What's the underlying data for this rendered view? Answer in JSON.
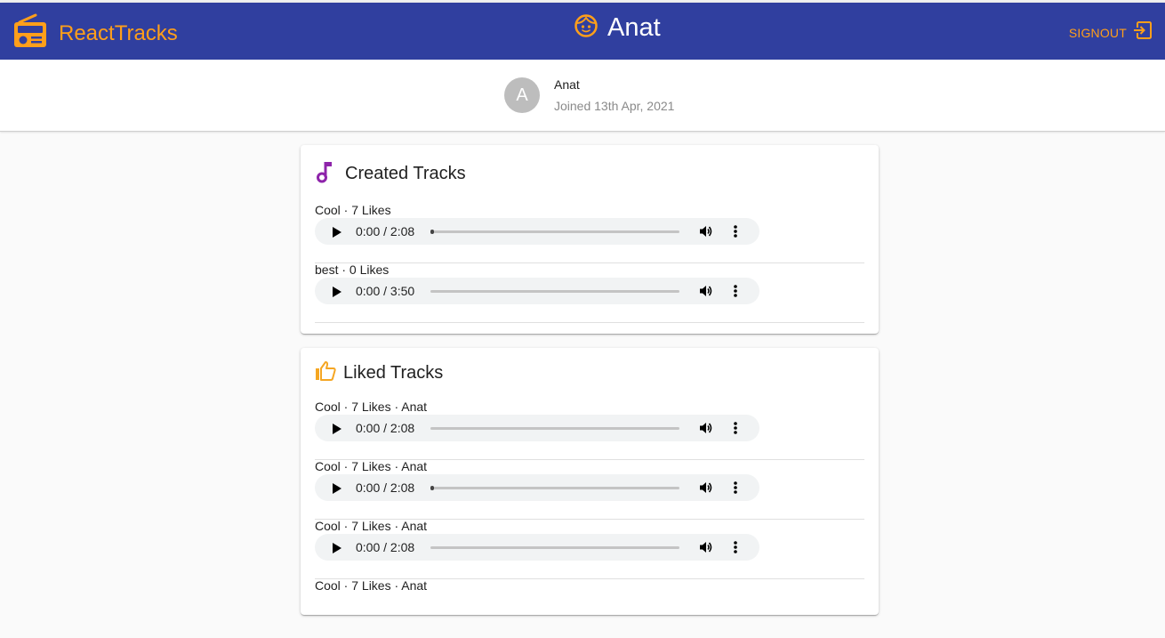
{
  "header": {
    "brand": "ReactTracks",
    "user_name": "Anat",
    "signout": "SIGNOUT",
    "accent": "#ff9f1a",
    "bar_color": "#303f9f"
  },
  "profile": {
    "avatar_letter": "A",
    "name": "Anat",
    "joined": "Joined 13th Apr, 2021"
  },
  "created": {
    "title": "Created Tracks",
    "icon": "music-note-icon",
    "tracks": [
      {
        "meta": "Cool · 7 Likes",
        "time": "0:00 / 2:08",
        "progress": 0
      },
      {
        "meta": "best · 0 Likes",
        "time": "0:00 / 3:50",
        "progress": 0
      }
    ]
  },
  "liked": {
    "title": "Liked Tracks",
    "icon": "thumb-up-icon",
    "tracks": [
      {
        "meta": "Cool · 7 Likes · Anat",
        "time": "0:00 / 2:08",
        "progress": 0
      },
      {
        "meta": "Cool · 7 Likes · Anat",
        "time": "0:00 / 2:08",
        "progress": 0
      },
      {
        "meta": "Cool · 7 Likes · Anat",
        "time": "0:00 / 2:08",
        "progress": 0
      },
      {
        "meta": "Cool · 7 Likes · Anat"
      }
    ]
  }
}
